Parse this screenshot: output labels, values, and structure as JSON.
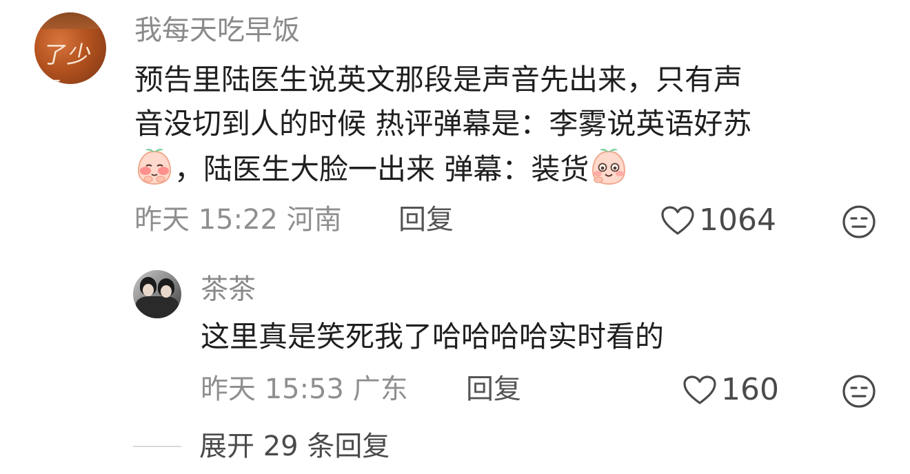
{
  "comments": [
    {
      "username": "我每天吃早饭",
      "avatar_text": "了少有",
      "text_lines": {
        "l1": "预告里陆医生说英文那段是声音先出来，只有声",
        "l2": "音没切到人的时候 热评弹幕是：李雾说英语好苏",
        "l3a": "，陆医生大脸一出来 弹幕：装货"
      },
      "emoji_1": "shy-peach-emoji",
      "emoji_2": "smiling-peach-emoji",
      "time": "昨天 15:22",
      "location": "河南",
      "reply_label": "回复",
      "likes": "1064"
    },
    {
      "username": "茶茶",
      "text": "这里真是笑死我了哈哈哈哈实时看的",
      "time": "昨天 15:53",
      "location": "广东",
      "reply_label": "回复",
      "likes": "160"
    }
  ],
  "expand": {
    "label": "展开 29 条回复"
  },
  "icons": {
    "like": "heart-outline-icon",
    "dislike": "meh-face-icon"
  },
  "colors": {
    "username": "#8a8a8a",
    "text": "#1f1f1f",
    "meta": "#8f8f8f",
    "action": "#545454"
  }
}
